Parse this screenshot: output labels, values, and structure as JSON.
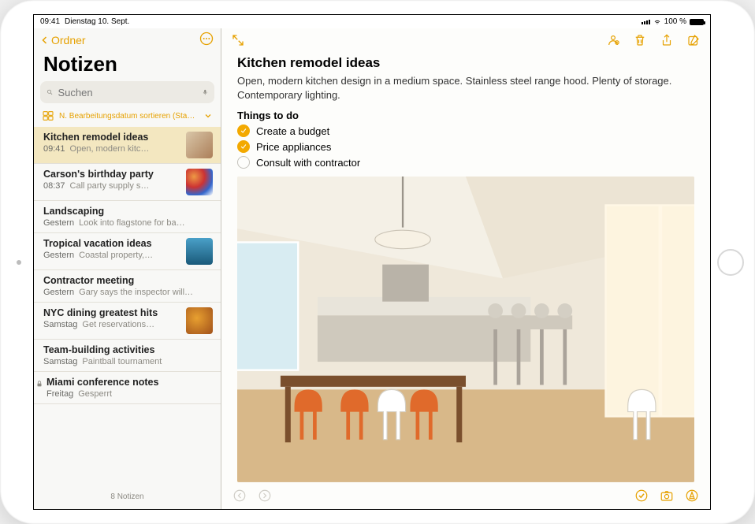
{
  "status": {
    "time": "09:41",
    "date": "Dienstag 10. Sept.",
    "battery_pct": "100 %"
  },
  "sidebar": {
    "back_label": "Ordner",
    "title": "Notizen",
    "search_placeholder": "Suchen",
    "sort_label": "N. Bearbeitungsdatum sortieren (Standard)",
    "count_label": "8 Notizen"
  },
  "notes": [
    {
      "title": "Kitchen remodel ideas",
      "time": "09:41",
      "snippet": "Open, modern kitc…",
      "thumb": "kitchen",
      "selected": true
    },
    {
      "title": "Carson's birthday party",
      "time": "08:37",
      "snippet": "Call party supply s…",
      "thumb": "candy"
    },
    {
      "title": "Landscaping",
      "time": "Gestern",
      "snippet": "Look into flagstone for ba…"
    },
    {
      "title": "Tropical vacation ideas",
      "time": "Gestern",
      "snippet": "Coastal property,…",
      "thumb": "tropical"
    },
    {
      "title": "Contractor meeting",
      "time": "Gestern",
      "snippet": "Gary says the inspector will…"
    },
    {
      "title": "NYC dining greatest hits",
      "time": "Samstag",
      "snippet": "Get reservations…",
      "thumb": "food"
    },
    {
      "title": "Team-building activities",
      "time": "Samstag",
      "snippet": "Paintball tournament"
    },
    {
      "title": "Miami conference notes",
      "time": "Freitag",
      "snippet": "Gesperrt",
      "locked": true
    }
  ],
  "detail": {
    "title": "Kitchen remodel ideas",
    "description": "Open, modern kitchen design in a medium space. Stainless steel range hood. Plenty of storage. Contemporary lighting.",
    "subheading": "Things to do",
    "todos": [
      {
        "label": "Create a budget",
        "done": true
      },
      {
        "label": "Price appliances",
        "done": true
      },
      {
        "label": "Consult with contractor",
        "done": false
      }
    ]
  },
  "colors": {
    "accent": "#e6a100"
  }
}
